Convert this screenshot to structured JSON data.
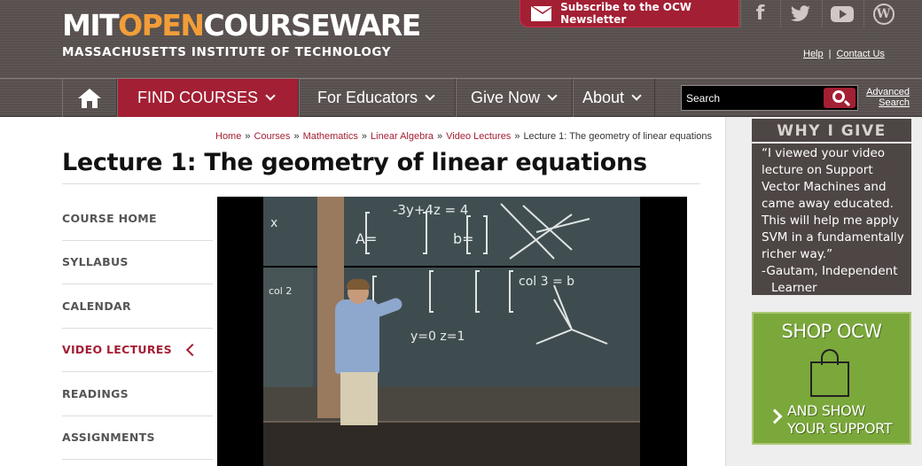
{
  "header": {
    "logo_part1": "MIT",
    "logo_part2": "OPEN",
    "logo_part3": "COURSEWARE",
    "logo_subtitle": "MASSACHUSETTS INSTITUTE OF TECHNOLOGY",
    "newsletter_label": "Subscribe to the OCW Newsletter",
    "social_icons": [
      "facebook-icon",
      "twitter-icon",
      "youtube-icon",
      "wordpress-icon"
    ],
    "help_link": "Help",
    "link_separator": "|",
    "contact_link": "Contact Us",
    "accent_color": "#a31f34",
    "brand_orange": "#f29d38"
  },
  "nav": {
    "find_courses": "FIND COURSES",
    "for_educators": "For Educators",
    "give_now": "Give Now",
    "about": "About",
    "search_placeholder": "Search",
    "advanced_search_line1": "Advanced",
    "advanced_search_line2": "Search"
  },
  "breadcrumb": {
    "items": [
      "Home",
      "Courses",
      "Mathematics",
      "Linear Algebra",
      "Video Lectures"
    ],
    "separator": "»",
    "current": "Lecture 1: The geometry of linear equations"
  },
  "page": {
    "title": "Lecture 1: The geometry of linear equations"
  },
  "sidebar": {
    "items": [
      {
        "label": "COURSE HOME",
        "active": false
      },
      {
        "label": "SYLLABUS",
        "active": false
      },
      {
        "label": "CALENDAR",
        "active": false
      },
      {
        "label": "VIDEO LECTURES",
        "active": true
      },
      {
        "label": "READINGS",
        "active": false
      },
      {
        "label": "ASSIGNMENTS",
        "active": false
      }
    ]
  },
  "video": {
    "chalk_texts": [
      "-3y+4z = 4",
      "A=",
      "b=",
      "x",
      "y=0 z=1",
      "col 2",
      "col 3 = b"
    ]
  },
  "why_give": {
    "title": "WHY I GIVE",
    "quote": "“I viewed your video lecture on Support Vector Machines and came away educated. This will help me apply SVM in a fundamentally richer way.”",
    "author_line1": "-Gautam, Independent",
    "author_line2": "Learner"
  },
  "shop": {
    "title": "SHOP OCW",
    "subtitle_line1": "AND SHOW",
    "subtitle_line2": "YOUR SUPPORT"
  }
}
